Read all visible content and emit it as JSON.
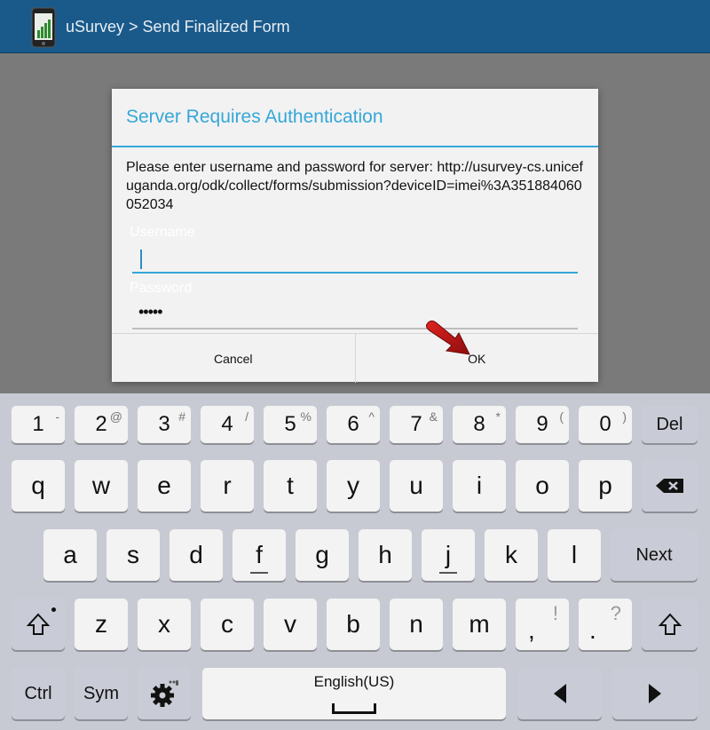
{
  "app": {
    "title": "uSurvey > Send Finalized Form",
    "icon": "phone-chart-icon"
  },
  "dialog": {
    "title": "Server Requires Authentication",
    "message": "Please enter username and password for server: http://usurvey-cs.unicefuganda.org/odk/collect/forms/submission?deviceID=imei%3A351884060052034",
    "username_label": "Username",
    "username_value": "",
    "password_label": "Password",
    "password_value": "•••••",
    "cancel_label": "Cancel",
    "ok_label": "OK",
    "accent_color": "#35a7d9"
  },
  "keyboard": {
    "row1": [
      {
        "main": "1",
        "sub": "-"
      },
      {
        "main": "2",
        "sub": "@"
      },
      {
        "main": "3",
        "sub": "#"
      },
      {
        "main": "4",
        "sub": "/"
      },
      {
        "main": "5",
        "sub": "%"
      },
      {
        "main": "6",
        "sub": "^"
      },
      {
        "main": "7",
        "sub": "&"
      },
      {
        "main": "8",
        "sub": "*"
      },
      {
        "main": "9",
        "sub": "("
      },
      {
        "main": "0",
        "sub": ")"
      }
    ],
    "del_label": "Del",
    "row2": [
      "q",
      "w",
      "e",
      "r",
      "t",
      "y",
      "u",
      "i",
      "o",
      "p"
    ],
    "backspace_icon": "backspace-icon",
    "row3": [
      "a",
      "s",
      "d",
      "f",
      "g",
      "h",
      "j",
      "k",
      "l"
    ],
    "next_label": "Next",
    "row4": [
      "z",
      "x",
      "c",
      "v",
      "b",
      "n",
      "m"
    ],
    "comma": {
      "main": ",",
      "sub": "!"
    },
    "period": {
      "main": ".",
      "sub": "?"
    },
    "shift_icon": "shift-icon",
    "ctrl_label": "Ctrl",
    "sym_label": "Sym",
    "settings_icon": "gear-icon",
    "space_label": "English(US)",
    "left_icon": "arrow-left-icon",
    "right_icon": "arrow-right-icon"
  }
}
